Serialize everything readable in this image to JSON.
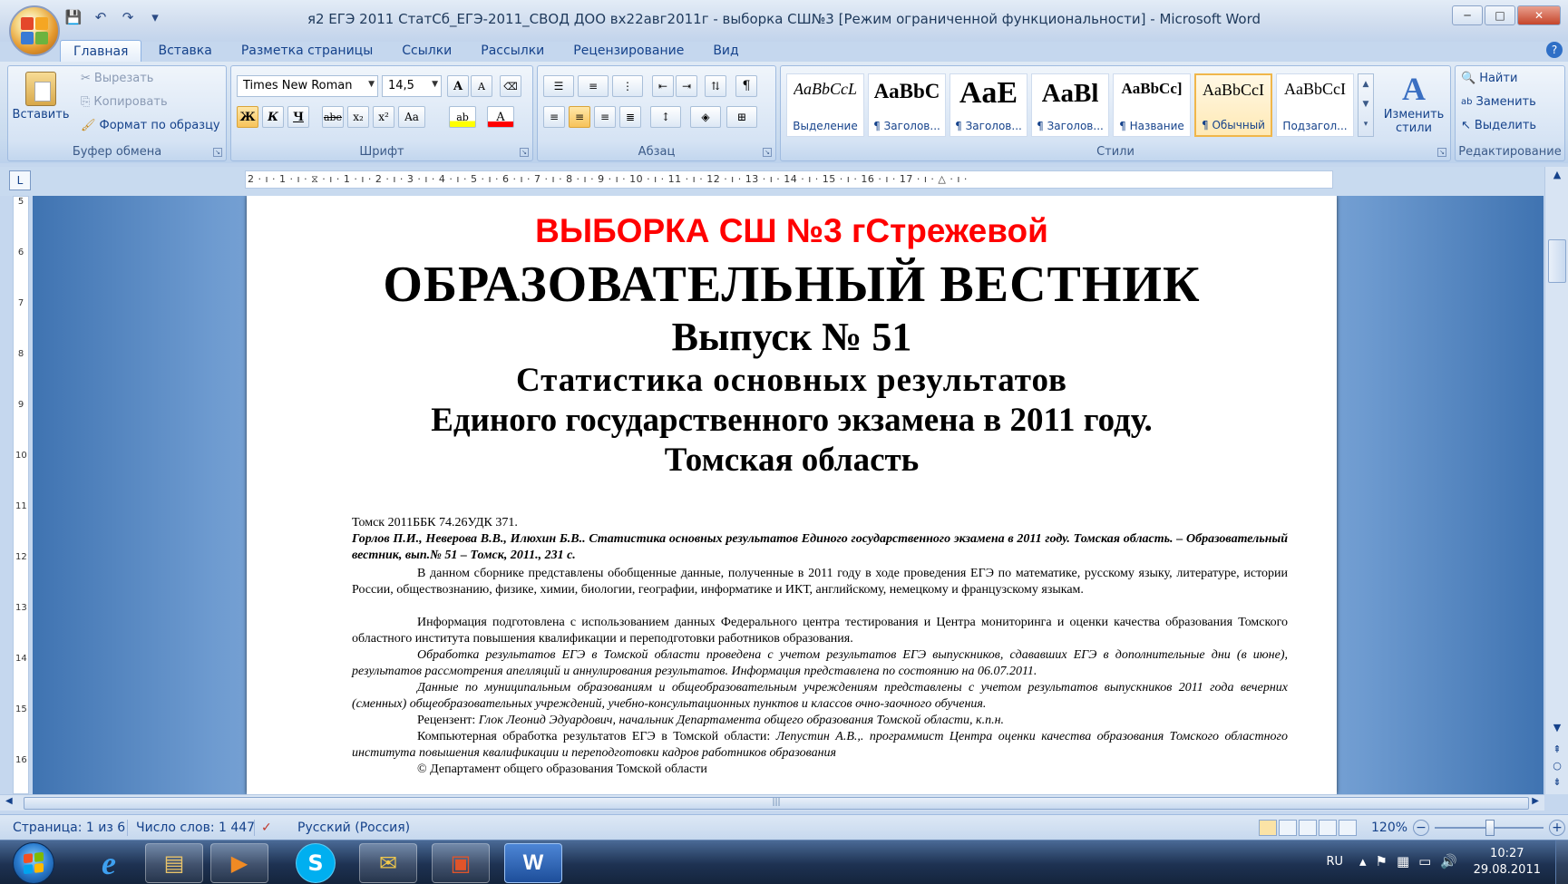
{
  "window": {
    "title": "я2 ЕГЭ 2011 СтатСб_ЕГЭ-2011_СВОД ДОО вх22авг2011г - выборка СШ№3 [Режим ограниченной функциональности] - Microsoft Word",
    "controls": {
      "minimize": "─",
      "maximize": "□",
      "close": "✕"
    }
  },
  "quick_access": {
    "save": "💾",
    "undo": "↶",
    "redo": "↷",
    "customize": "▾"
  },
  "tabs": [
    "Главная",
    "Вставка",
    "Разметка страницы",
    "Ссылки",
    "Рассылки",
    "Рецензирование",
    "Вид"
  ],
  "active_tab": "Главная",
  "ribbon": {
    "clipboard": {
      "label": "Буфер обмена",
      "paste": "Вставить",
      "cut": "Вырезать",
      "copy": "Копировать",
      "format_painter": "Формат по образцу"
    },
    "font": {
      "label": "Шрифт",
      "font_name": "Times New Roman",
      "font_size": "14,5",
      "bold": "Ж",
      "italic": "К",
      "underline": "Ч",
      "strike": "abe",
      "subscript": "x₂",
      "superscript": "x²",
      "case": "Aa",
      "grow": "A",
      "shrink": "A",
      "clear": "⌫",
      "highlight": "ab",
      "color": "A"
    },
    "paragraph": {
      "label": "Абзац"
    },
    "styles": {
      "label": "Стили",
      "tiles": [
        {
          "sample": "AaBbCcL",
          "name": "Выделение"
        },
        {
          "sample": "AaBbC",
          "name": "¶ Заголов..."
        },
        {
          "sample": "AaE",
          "name": "¶ Заголов..."
        },
        {
          "sample": "AaBl",
          "name": "¶ Заголов..."
        },
        {
          "sample": "AaBbCc]",
          "name": "¶ Название"
        },
        {
          "sample": "AaBbCcI",
          "name": "¶ Обычный"
        },
        {
          "sample": "AaBbCcI",
          "name": "Подзагол..."
        }
      ],
      "change_styles": "Изменить стили"
    },
    "editing": {
      "label": "Редактирование",
      "find": "Найти",
      "replace": "Заменить",
      "select": "Выделить"
    }
  },
  "ruler": {
    "corner": "L",
    "horizontal": "2 · ı · 1 · ı · ⧖ · ı · 1 · ı · 2 · ı · 3 · ı · 4 · ı · 5 · ı · 6 · ı · 7 · ı · 8 · ı · 9 · ı · 10 · ı · 11 · ı · 12 · ı · 13 · ı · 14 · ı · 15 · ı · 16 · ı · 17 · ı · △ · ı ·",
    "vertical": [
      "5",
      "6",
      "7",
      "8",
      "9",
      "10",
      "11",
      "12",
      "13",
      "14",
      "15",
      "16"
    ]
  },
  "document": {
    "red_heading": "ВЫБОРКА СШ №3  гСтрежевой",
    "title": "ОБРАЗОВАТЕЛЬНЫЙ ВЕСТНИК",
    "issue": "Выпуск № 51",
    "subtitle_1": "Статистика основных результатов",
    "subtitle_2": "Единого государственного экзамена в 2011 году.",
    "subtitle_3": "Томская область",
    "p1": "Томск 2011ББК 74.26УДК 371.",
    "p2": "Горлов П.И., Неверова В.В., Илюхин Б.В.. Статистика основных результатов Единого государственного экзамена в 2011 году. Томская область. – Образовательный вестник, вып.№ 51 – Томск, 2011., 231 с.",
    "p3": "В данном сборнике представлены обобщенные данные, полученные в 2011 году в ходе проведения ЕГЭ по математике, русскому языку, литературе, истории России, обществознанию, физике, химии, биологии, географии, информатике и ИКТ, английскому, немецкому и французскому языкам.",
    "p4": "Информация подготовлена  с использованием данных Федерального центра тестирования и Центра мониторинга и оценки качества образования Томского областного института повышения квалификации и переподготовки работников образования.",
    "p5": "Обработка результатов ЕГЭ в Томской области проведена с учетом результатов ЕГЭ выпускников, сдававших ЕГЭ в дополнительные дни (в июне), результатов рассмотрения апелляций и аннулирования результатов. Информация представлена по состоянию на 06.07.2011.",
    "p6": "Данные по муниципальным образованиям и общеобразовательным учреждениям представлены с учетом результатов выпускников 2011 года вечерних (сменных) общеобразовательных учреждений, учебно-консультационных пунктов и классов очно-заочного обучения.",
    "p7_label": "Рецензент: ",
    "p7_value": "Глок Леонид Эдуардович, начальник Департамента общего образования Томской области, к.п.н.",
    "p8_label": "Компьютерная обработка результатов ЕГЭ в Томской области: ",
    "p8_value": "Лепустин А.В.,. программист Центра оценки качества образования Томского областного института повышения квалификации и переподготовки кадров работников образования",
    "p9": "© Департамент общего образования Томской области"
  },
  "statusbar": {
    "page": "Страница: 1 из 6",
    "words": "Число слов: 1 447",
    "language": "Русский (Россия)",
    "zoom": "120%",
    "zoom_minus": "−",
    "zoom_plus": "+"
  },
  "taskbar": {
    "language": "RU",
    "time": "10:27",
    "date": "29.08.2011",
    "apps": [
      {
        "icon": "internet-explorer-icon",
        "glyph": "e"
      },
      {
        "icon": "explorer-icon",
        "glyph": "▤"
      },
      {
        "icon": "media-player-icon",
        "glyph": "▶"
      },
      {
        "icon": "skype-icon",
        "glyph": "S"
      },
      {
        "icon": "outlook-icon",
        "glyph": "✉"
      },
      {
        "icon": "presentation-icon",
        "glyph": "▣"
      },
      {
        "icon": "word-icon",
        "glyph": "W"
      }
    ]
  },
  "colors": {
    "ribbon_text": "#15428b",
    "red_heading": "#ff0000",
    "taskbar": "#1e3252",
    "active_style_border": "#f0b64a"
  }
}
